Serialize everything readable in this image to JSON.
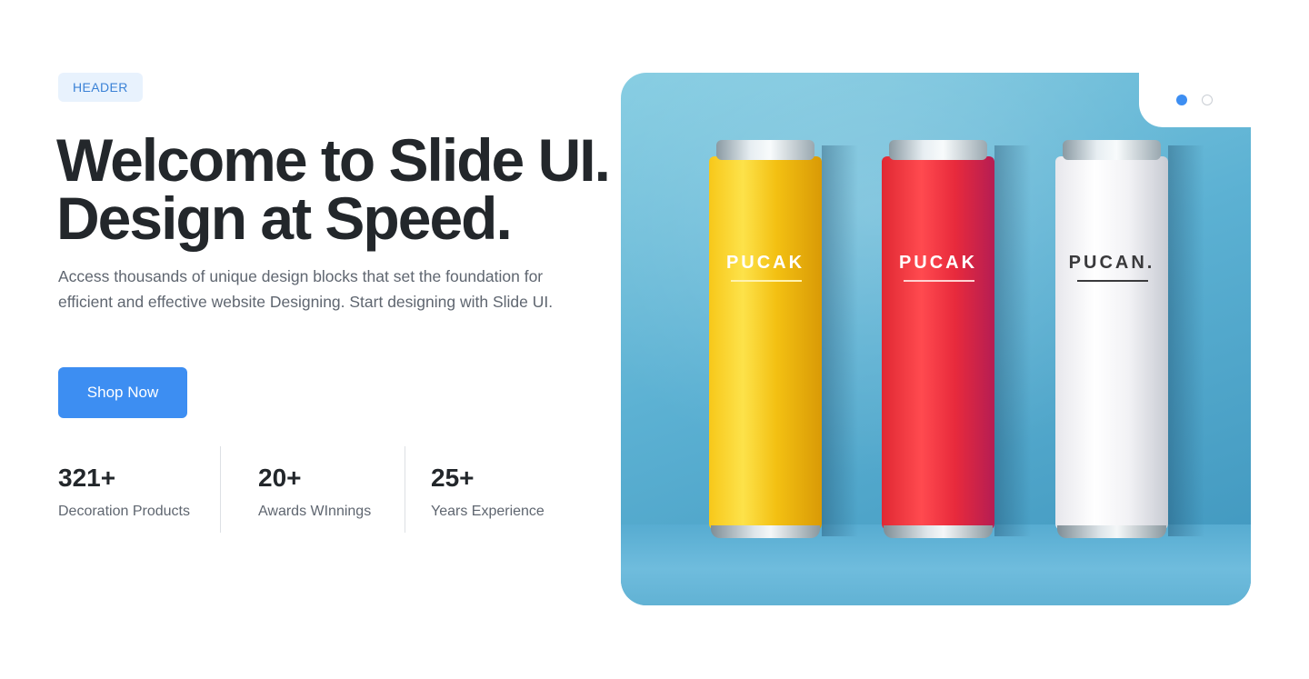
{
  "header_badge": "HEADER",
  "headline": "Welcome to Slide UI. Design at Speed.",
  "lead": "Access thousands of unique design blocks that set the foundation for efficient and effective website Designing. Start designing with Slide UI.",
  "cta_label": "Shop Now",
  "stats": [
    {
      "value": "321+",
      "label": "Decoration Products"
    },
    {
      "value": "20+",
      "label": "Awards WInnings"
    },
    {
      "value": "25+",
      "label": "Years Experience"
    }
  ],
  "hero": {
    "cans": [
      {
        "brand": "PUCAK",
        "color": "#f7c81a"
      },
      {
        "brand": "PUCAK",
        "color": "#e8293b"
      },
      {
        "brand": "PUCAN.",
        "color": "#f2f2f5"
      }
    ],
    "slider": {
      "active_index": 0,
      "count": 2,
      "active_color": "#3d8ef2"
    }
  },
  "accent_color": "#3d8ef2"
}
